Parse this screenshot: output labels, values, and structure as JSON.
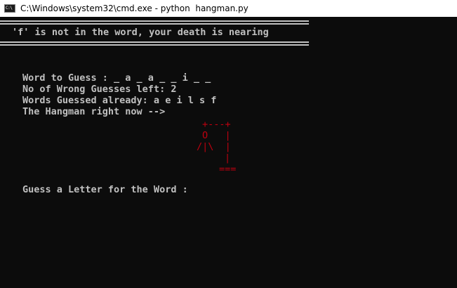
{
  "window": {
    "title": "C:\\Windows\\system32\\cmd.exe - python  hangman.py",
    "icon": "cmd-icon",
    "icon_text": "C:\\"
  },
  "console": {
    "message": "'f' is not in the word, your death is nearing",
    "word_to_guess": "Word to Guess : _ a _ a _ _ i _ _",
    "wrong_guesses_left": "No of Wrong Guesses left: 2",
    "words_guessed": "Words Guessed already: a e i l s f",
    "hangman_label": "The Hangman right now -->",
    "prompt": "Guess a Letter for the Word :",
    "hangman_art": {
      "line1": "+---+",
      "line2": "O   |",
      "line3": "/|\\  |",
      "line4": "|",
      "line5": "==="
    }
  },
  "colors": {
    "background": "#0c0c0c",
    "text": "#c0c0c0",
    "hangman": "#c0000f",
    "titlebar": "#ffffff"
  }
}
